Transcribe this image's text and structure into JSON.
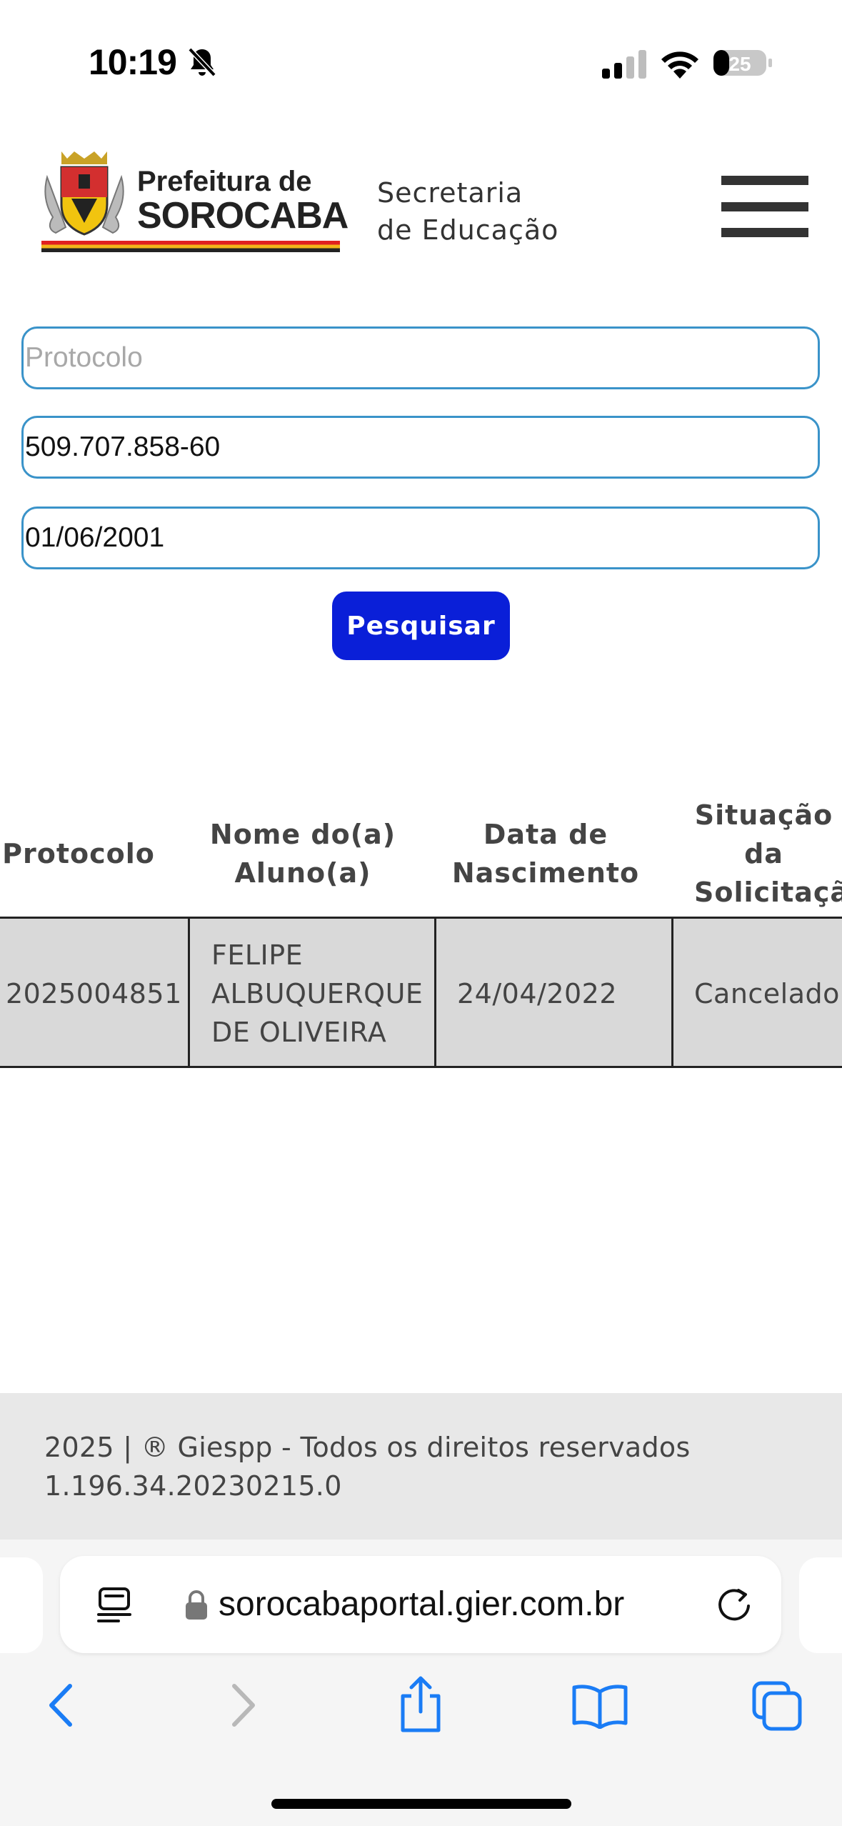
{
  "status_bar": {
    "time": "10:19",
    "battery": "25",
    "icons": [
      "bell-slash-icon",
      "cellular-signal-icon",
      "wifi-icon",
      "battery-icon"
    ]
  },
  "header": {
    "logo_line1": "Prefeitura de",
    "logo_line2": "SOROCABA",
    "secretaria_line1": "Secretaria",
    "secretaria_line2": "de Educação",
    "menu_icon": "hamburger-menu-icon"
  },
  "form": {
    "protocolo_placeholder": "Protocolo",
    "protocolo_value": "",
    "cpf_value": "509.707.858-60",
    "birthdate_value": "01/06/2001",
    "search_label": "Pesquisar"
  },
  "table": {
    "headers": [
      [
        "Protocolo"
      ],
      [
        "Nome do(a)",
        "Aluno(a)"
      ],
      [
        "Data de",
        "Nascimento"
      ],
      [
        "Situação",
        "da",
        "Solicitação"
      ]
    ],
    "rows": [
      {
        "protocolo": "2025004851",
        "nome": [
          "FELIPE",
          "ALBUQUERQUE",
          "DE OLIVEIRA"
        ],
        "nascimento": "24/04/2022",
        "situacao": "Cancelado"
      }
    ]
  },
  "footer": {
    "copyright": "2025 | ® Giespp - Todos os direitos reservados",
    "version": "1.196.34.20230215.0"
  },
  "browser": {
    "url": "sorocabaportal.gier.com.br",
    "icons": [
      "reader-icon",
      "lock-icon",
      "reload-icon",
      "back-icon",
      "forward-icon",
      "share-icon",
      "bookmarks-icon",
      "tabs-icon"
    ]
  },
  "colors": {
    "input_border": "#3a93c9",
    "button_bg": "#0a1fd8",
    "row_bg": "#d9d9d9",
    "footer_bg": "#e8e8e8",
    "safari_blue": "#1a7cf5"
  }
}
